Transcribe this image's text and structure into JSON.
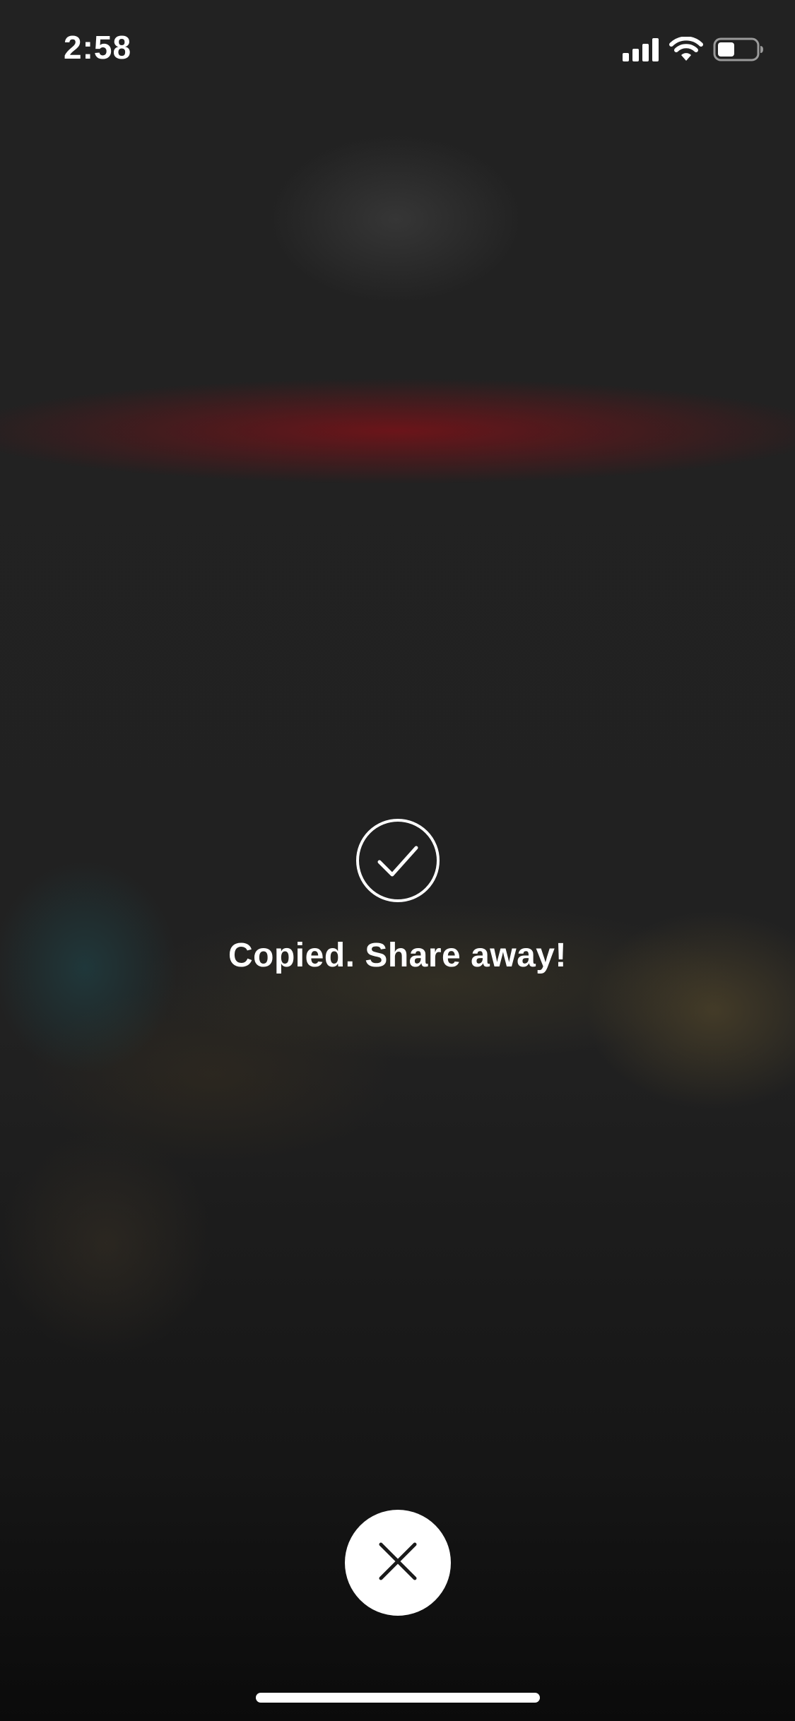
{
  "status_bar": {
    "time": "2:58",
    "icons": [
      "cellular-signal-icon",
      "wifi-icon",
      "battery-icon"
    ],
    "battery_level": 0.45
  },
  "confirmation": {
    "icon": "check-circle-icon",
    "message": "Copied. Share away!"
  },
  "close_button": {
    "icon": "close-icon"
  },
  "colors": {
    "foreground": "#ffffff",
    "background": "#1c1c1c",
    "blur_accent": "#78121a"
  }
}
